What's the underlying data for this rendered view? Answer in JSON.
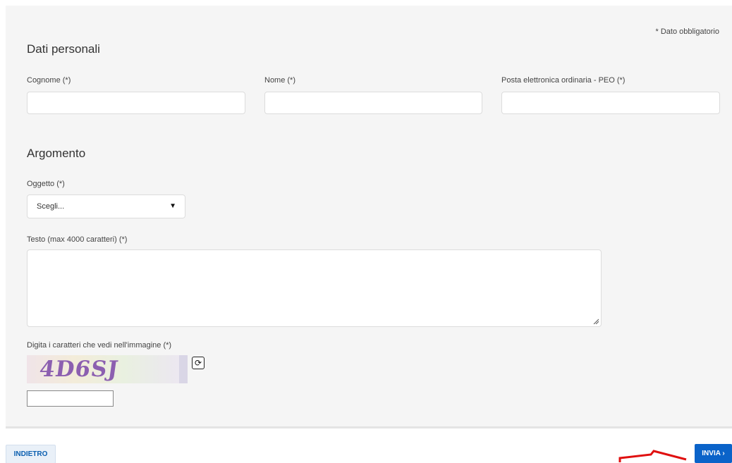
{
  "required_note": "* Dato obbligatorio",
  "personal": {
    "title": "Dati personali",
    "surname_label": "Cognome (*)",
    "surname_value": "",
    "name_label": "Nome (*)",
    "name_value": "",
    "email_label": "Posta elettronica ordinaria - PEO (*)",
    "email_value": ""
  },
  "topic": {
    "title": "Argomento",
    "subject_label": "Oggetto (*)",
    "subject_selected": "Scegli...",
    "text_label": "Testo (max 4000 caratteri) (*)",
    "text_value": ""
  },
  "captcha": {
    "label": "Digita i caratteri che vedi nell'immagine (*)",
    "image_text": "4D6SJ",
    "input_value": ""
  },
  "actions": {
    "back_label": "INDIETRO",
    "send_label": "INVIA ›"
  },
  "colors": {
    "accent": "#0a63c9",
    "annotation_arrow": "#e01010"
  }
}
